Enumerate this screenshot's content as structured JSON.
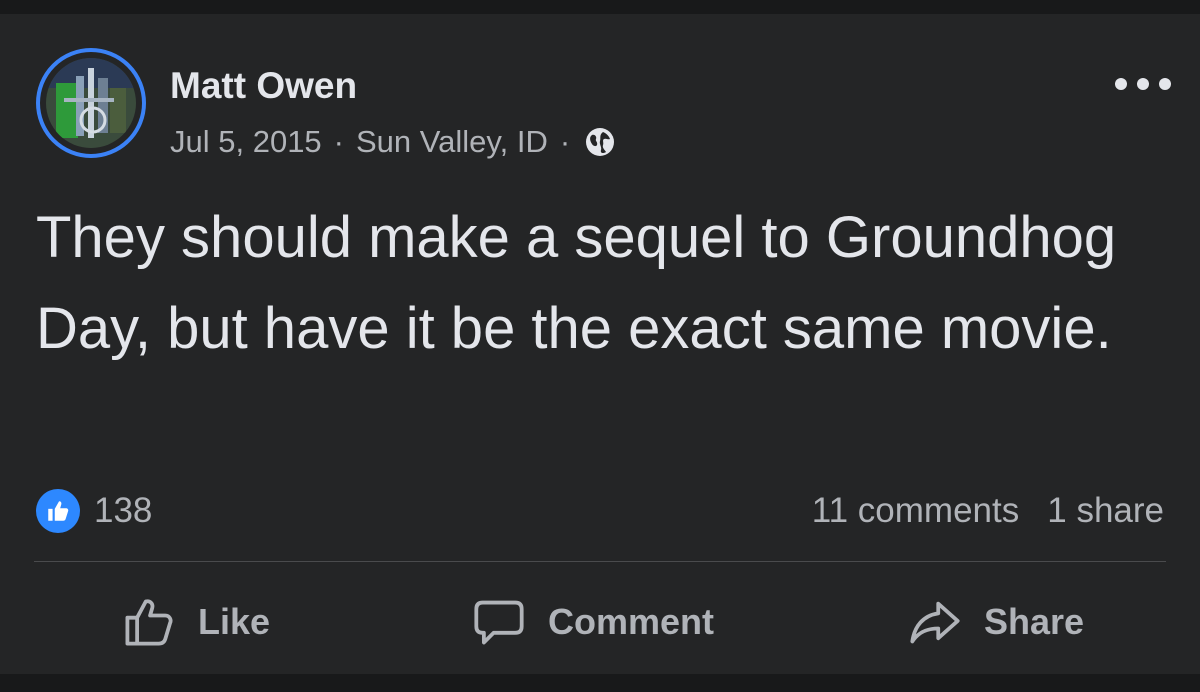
{
  "post": {
    "author": "Matt Owen",
    "date": "Jul 5, 2015",
    "separator": "·",
    "location": "Sun Valley, ID",
    "audience_icon": "globe-icon",
    "text": "They should make a sequel to Groundhog Day, but have it be the exact same movie."
  },
  "engagement": {
    "reaction_icon": "thumbs-up-icon",
    "reaction_count": "138",
    "comments": "11 comments",
    "shares": "1 share"
  },
  "actions": {
    "like": "Like",
    "comment": "Comment",
    "share": "Share"
  },
  "colors": {
    "background": "#242526",
    "text": "#e4e6eb",
    "secondary_text": "#b0b3b8",
    "accent": "#2d88ff",
    "avatar_ring": "#3b82f6"
  }
}
